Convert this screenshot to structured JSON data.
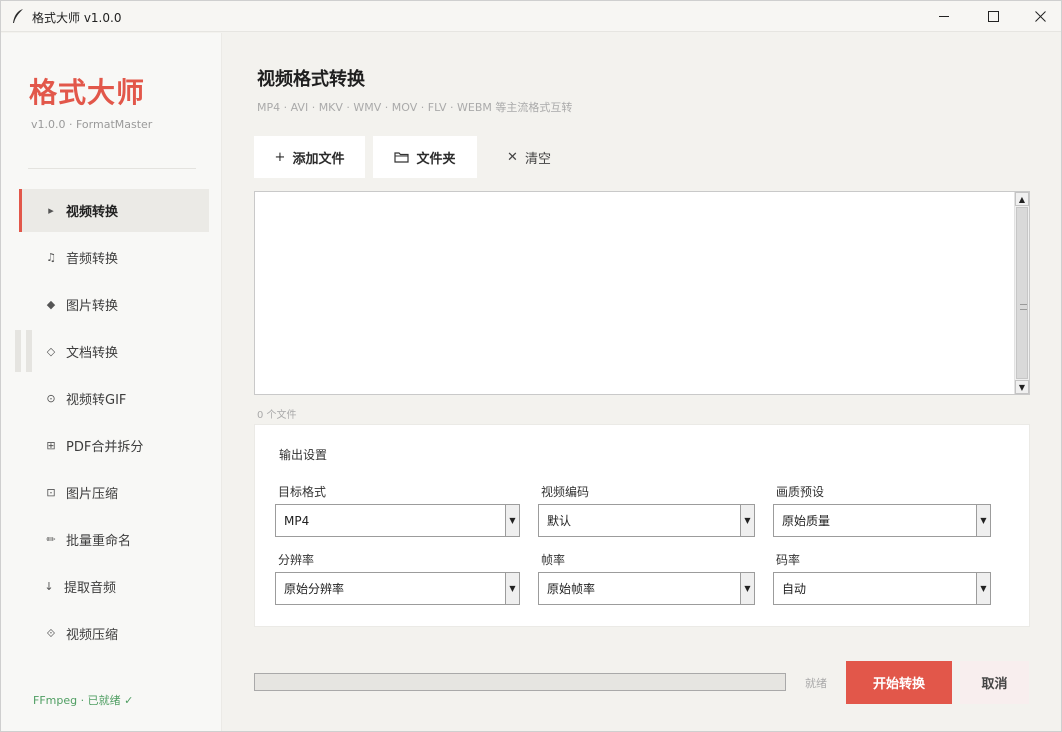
{
  "window": {
    "title": "格式大师 v1.0.0",
    "min_glyph": "─",
    "max_glyph": "☐",
    "close_glyph": "✕"
  },
  "sidebar": {
    "brand": "格式大师",
    "version": "v1.0.0  ·  FormatMaster",
    "items": [
      {
        "icon": "▸",
        "label": "视频转换"
      },
      {
        "icon": "♫",
        "label": "音频转换"
      },
      {
        "icon": "◆",
        "label": "图片转换"
      },
      {
        "icon": "◇",
        "label": "文档转换"
      },
      {
        "icon": "⊙",
        "label": "视频转GIF"
      },
      {
        "icon": "⊞",
        "label": "PDF合并拆分"
      },
      {
        "icon": "⊡",
        "label": "图片压缩"
      },
      {
        "icon": "✏",
        "label": "批量重命名"
      },
      {
        "icon": "↓",
        "label": "提取音频"
      },
      {
        "icon": "⟐",
        "label": "视频压缩"
      }
    ],
    "ffmpeg_status": "FFmpeg · 已就绪 ✓",
    "accent_color": "#e2574a"
  },
  "main": {
    "title": "视频格式转换",
    "subtitle": "MP4 · AVI · MKV · WMV · MOV · FLV · WEBM 等主流格式互转",
    "toolbar": {
      "add_icon": "+",
      "add_label": "添加文件",
      "folder_label": "文件夹",
      "clear_icon": "✕",
      "clear_label": "清空"
    },
    "file_count": "0 个文件",
    "settings": {
      "title": "输出设置",
      "fields": [
        {
          "label": "目标格式",
          "value": "MP4"
        },
        {
          "label": "视频编码",
          "value": "默认"
        },
        {
          "label": "画质预设",
          "value": "原始质量"
        },
        {
          "label": "分辨率",
          "value": "原始分辨率"
        },
        {
          "label": "帧率",
          "value": "原始帧率"
        },
        {
          "label": "码率",
          "value": "自动"
        }
      ]
    },
    "status": "就绪",
    "start_label": "开始转换",
    "cancel_label": "取消"
  }
}
